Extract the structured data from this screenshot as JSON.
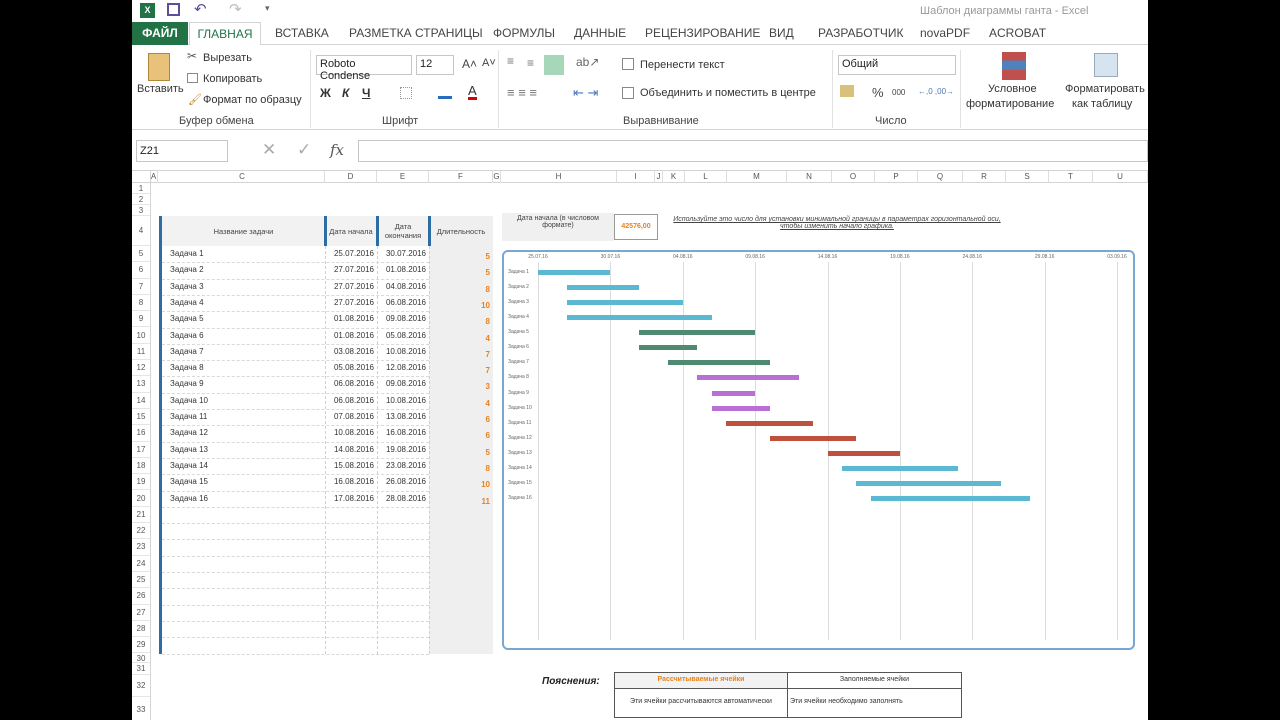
{
  "window": {
    "title": "Шаблон диаграммы ганта - Excel"
  },
  "tabs": {
    "file": "ФАЙЛ",
    "items": [
      "ГЛАВНАЯ",
      "ВСТАВКА",
      "РАЗМЕТКА СТРАНИЦЫ",
      "ФОРМУЛЫ",
      "ДАННЫЕ",
      "РЕЦЕНЗИРОВАНИЕ",
      "ВИД",
      "РАЗРАБОТЧИК",
      "novaPDF",
      "ACROBAT"
    ]
  },
  "ribbon": {
    "clipboard": {
      "paste": "Вставить",
      "cut": "Вырезать",
      "copy": "Копировать",
      "format_painter": "Формат по образцу",
      "group": "Буфер обмена"
    },
    "font": {
      "name": "Roboto Condense",
      "size": "12",
      "bold": "Ж",
      "italic": "К",
      "underline": "Ч",
      "group": "Шрифт"
    },
    "alignment": {
      "wrap": "Перенести текст",
      "merge": "Объединить и поместить в центре",
      "group": "Выравнивание"
    },
    "number": {
      "format": "Общий",
      "percent": "%",
      "thousands": "000",
      "group": "Число"
    },
    "styles": {
      "conditional_1": "Условное",
      "conditional_2": "форматирование",
      "table_1": "Форматировать",
      "table_2": "как таблицу"
    }
  },
  "formula_bar": {
    "name_box": "Z21",
    "fx": "fx",
    "value": ""
  },
  "columns": [
    "A",
    "B",
    "C",
    "D",
    "E",
    "F",
    "G",
    "H",
    "I",
    "J",
    "K",
    "L",
    "M",
    "N",
    "O",
    "P",
    "Q",
    "R",
    "S",
    "T",
    "U"
  ],
  "table": {
    "headers": [
      "Название задачи",
      "Дата начала",
      "Дата окончания",
      "Длительность"
    ],
    "rows": [
      [
        "Задача 1",
        "25.07.2016",
        "30.07.2016",
        "5"
      ],
      [
        "Задача 2",
        "27.07.2016",
        "01.08.2016",
        "5"
      ],
      [
        "Задача 3",
        "27.07.2016",
        "04.08.2016",
        "8"
      ],
      [
        "Задача 4",
        "27.07.2016",
        "06.08.2016",
        "10"
      ],
      [
        "Задача 5",
        "01.08.2016",
        "09.08.2016",
        "8"
      ],
      [
        "Задача 6",
        "01.08.2016",
        "05.08.2016",
        "4"
      ],
      [
        "Задача 7",
        "03.08.2016",
        "10.08.2016",
        "7"
      ],
      [
        "Задача 8",
        "05.08.2016",
        "12.08.2016",
        "7"
      ],
      [
        "Задача 9",
        "06.08.2016",
        "09.08.2016",
        "3"
      ],
      [
        "Задача 10",
        "06.08.2016",
        "10.08.2016",
        "4"
      ],
      [
        "Задача 11",
        "07.08.2016",
        "13.08.2016",
        "6"
      ],
      [
        "Задача 12",
        "10.08.2016",
        "16.08.2016",
        "6"
      ],
      [
        "Задача 13",
        "14.08.2016",
        "19.08.2016",
        "5"
      ],
      [
        "Задача 14",
        "15.08.2016",
        "23.08.2016",
        "8"
      ],
      [
        "Задача 15",
        "16.08.2016",
        "26.08.2016",
        "10"
      ],
      [
        "Задача 16",
        "17.08.2016",
        "28.08.2016",
        "11"
      ]
    ]
  },
  "start_numeric": {
    "label": "Дата начала (в числовом формате)",
    "value": "42576,00"
  },
  "hint": "Используйте это число для установки минимальной границы в параметрах горизонтальной оси, чтобы изменить начало графика.",
  "legend": {
    "title": "Пояснения:",
    "calc_header": "Рассчитываемые ячейки",
    "calc_text": "Эти ячейки рассчитываются автоматически",
    "fill_header": "Заполняемые ячейки",
    "fill_text": "Эти ячейки необходимо заполнять"
  },
  "chart_data": {
    "type": "bar",
    "subtype": "gantt",
    "x_ticks": [
      "25.07.16",
      "30.07.16",
      "04.08.16",
      "09.08.16",
      "14.08.16",
      "19.08.16",
      "24.08.16",
      "29.08.16",
      "03.09.16"
    ],
    "x_range_days": [
      0,
      40
    ],
    "categories": [
      "Задача 1",
      "Задача 2",
      "Задача 3",
      "Задача 4",
      "Задача 5",
      "Задача 6",
      "Задача 7",
      "Задача 8",
      "Задача 9",
      "Задача 10",
      "Задача 11",
      "Задача 12",
      "Задача 13",
      "Задача 14",
      "Задача 15",
      "Задача 16"
    ],
    "start_offset_days": [
      0,
      2,
      2,
      2,
      7,
      7,
      9,
      11,
      12,
      12,
      13,
      16,
      20,
      21,
      22,
      23
    ],
    "duration_days": [
      5,
      5,
      8,
      10,
      8,
      4,
      7,
      7,
      3,
      4,
      6,
      6,
      5,
      8,
      10,
      11
    ],
    "colors": [
      "#5bb8d2",
      "#5bb8d2",
      "#5bb8d2",
      "#5bb8d2",
      "#4f8a70",
      "#4f8a70",
      "#4f8a70",
      "#b86fd6",
      "#b86fd6",
      "#b86fd6",
      "#c0503e",
      "#c0503e",
      "#c0503e",
      "#5bb8d2",
      "#5bb8d2",
      "#5bb8d2"
    ]
  },
  "colors": {
    "excel_green": "#217346",
    "accent_orange": "#e8821e",
    "table_blue": "#2e6da4"
  }
}
